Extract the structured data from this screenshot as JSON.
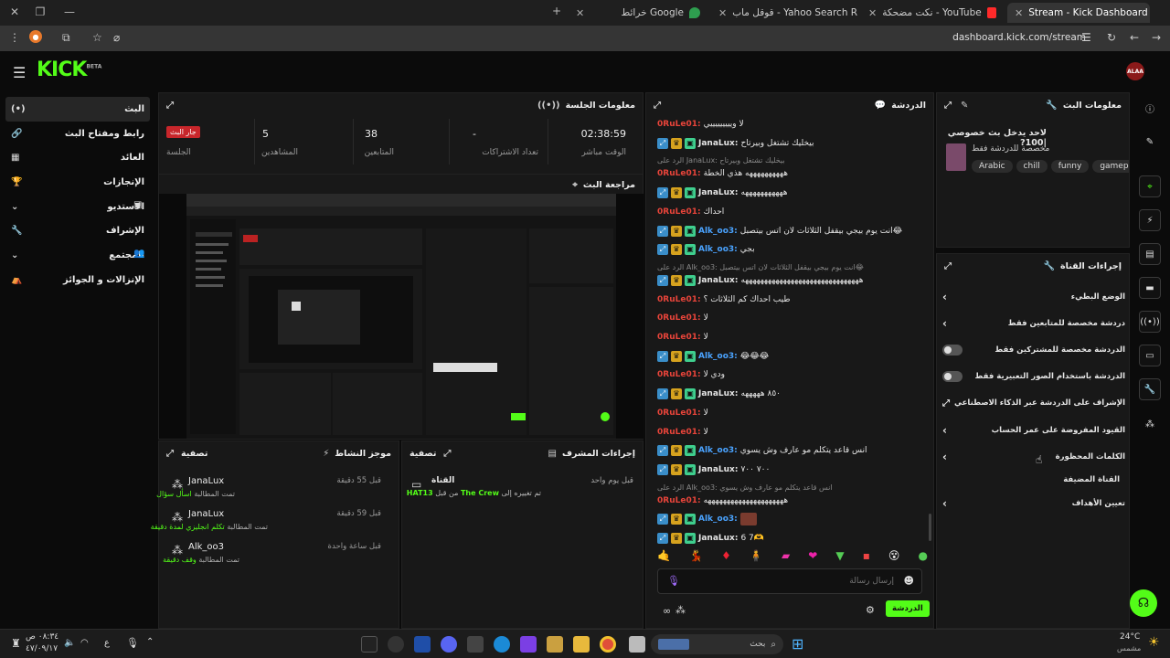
{
  "browser": {
    "tabs": [
      {
        "title": "Stream - Kick Dashboard",
        "active": true
      },
      {
        "title": "نكت مضحكة - YouTube",
        "active": false
      },
      {
        "title": "قوقل ماب - Yahoo Search Results",
        "active": false
      },
      {
        "title": "خرائط Google",
        "active": false
      }
    ],
    "url": "dashboard.kick.com/stream"
  },
  "header": {
    "logo": "KICK",
    "logo_sup": "BETA",
    "avatar": "ALAA"
  },
  "sidebar": {
    "items": [
      {
        "label": "البث",
        "icon": "(•)"
      },
      {
        "label": "رابط ومفتاح البث",
        "icon": "🔗"
      },
      {
        "label": "العائد",
        "icon": "▦"
      },
      {
        "label": "الإنجازات",
        "icon": "🏆"
      },
      {
        "label": "الاستديو",
        "icon": "▣"
      },
      {
        "label": "الإشراف",
        "icon": "🔧"
      },
      {
        "label": "المجتمع",
        "icon": "👥"
      },
      {
        "label": "الإنزالات و الجوائز",
        "icon": "⛺"
      }
    ]
  },
  "session": {
    "title": "معلومات الجلسة",
    "live_badge": "جار البث",
    "session_label": "الجلسة",
    "stats": [
      {
        "value": "02:38:59",
        "label": "الوقت مباشر"
      },
      {
        "value": "-",
        "label": "تعداد الاشتراكات"
      },
      {
        "value": "38",
        "label": "المتابعين"
      },
      {
        "value": "5",
        "label": "المشاهدين"
      }
    ]
  },
  "preview": {
    "title": "مراجعة البث"
  },
  "activity": {
    "title": "موجز النشاط",
    "filter": "تصفية",
    "items": [
      {
        "name": "JanaLux",
        "time": "قبل 55 دقيقة",
        "sub_prefix": "تمت المطالبة",
        "sub_reward": "اسأل سؤال"
      },
      {
        "name": "JanaLux",
        "time": "قبل 59 دقيقة",
        "sub_prefix": "تمت المطالبة",
        "sub_reward": "تكلم انجليزي لمدة دقيقة"
      },
      {
        "name": "Alk_oo3",
        "time": "قبل ساعة واحدة",
        "sub_prefix": "تمت المطالبة",
        "sub_reward": "وقف دقيقة"
      }
    ]
  },
  "modactions": {
    "title": "إجراءات المشرف",
    "filter": "تصفية",
    "item_title": "القناة",
    "item_time": "قبل يوم واحد",
    "item_text_prefix": "تم تغييره إلى",
    "item_user": "The Crew",
    "item_text_mid": "من قبل",
    "item_mod": "HAT13"
  },
  "chat": {
    "title": "الدردشة",
    "messages": [
      {
        "user": "0RuLe01:",
        "text": "لا ويييييييييي",
        "color": "#e8443a",
        "badges": []
      },
      {
        "user": "JanaLux:",
        "text": "بيخليك تشتغل وبيرتاح",
        "color": "#e6e6e6",
        "badges": [
          "mod",
          "crown",
          "sub"
        ]
      },
      {
        "reply": "الرد على JanaLux: بيخليك تشتغل وبيرتاح"
      },
      {
        "user": "0RuLe01:",
        "text": "ههههههههههه هذي الخطة",
        "color": "#e8443a",
        "badges": []
      },
      {
        "user": "JanaLux:",
        "text": "هههههههههههه",
        "color": "#e6e6e6",
        "badges": [
          "mod",
          "crown",
          "sub"
        ]
      },
      {
        "user": "0RuLe01:",
        "text": "احداك",
        "color": "#e8443a",
        "badges": []
      },
      {
        "user": "Alk_oo3:",
        "text": "انت يوم بيجي بيقفل الثلاثات لان اتس بيتصبل😂",
        "color": "#4aa3ff",
        "badges": [
          "mod",
          "crown",
          "sub"
        ]
      },
      {
        "user": "Alk_oo3:",
        "text": "بجي",
        "color": "#4aa3ff",
        "badges": [
          "mod",
          "crown",
          "sub"
        ]
      },
      {
        "reply": "الرد على Alk_oo3: انت يوم بيجي بيقفل الثلاثات لان اتس بيتصبل😂"
      },
      {
        "user": "JanaLux:",
        "text": "هههههههههههههههههههههههههههههههه",
        "color": "#e6e6e6",
        "badges": [
          "mod",
          "crown",
          "sub"
        ]
      },
      {
        "user": "0RuLe01:",
        "text": "طيب احداك كم الثلاثات ؟",
        "color": "#e8443a",
        "badges": []
      },
      {
        "user": "0RuLe01:",
        "text": "لا",
        "color": "#e8443a",
        "badges": []
      },
      {
        "user": "0RuLe01:",
        "text": "لا",
        "color": "#e8443a",
        "badges": []
      },
      {
        "user": "Alk_oo3:",
        "text": "😂😂😂",
        "color": "#4aa3ff",
        "badges": [
          "mod",
          "crown",
          "sub"
        ]
      },
      {
        "user": "0RuLe01:",
        "text": "ودي لا",
        "color": "#e8443a",
        "badges": []
      },
      {
        "user": "JanaLux:",
        "text": "٨٥٠ هههههه",
        "color": "#e6e6e6",
        "badges": [
          "mod",
          "crown",
          "sub"
        ]
      },
      {
        "user": "0RuLe01:",
        "text": "لا",
        "color": "#e8443a",
        "badges": []
      },
      {
        "user": "0RuLe01:",
        "text": "لا",
        "color": "#e8443a",
        "badges": []
      },
      {
        "user": "Alk_oo3:",
        "text": "انس قاعد يتكلم مو عارف وش يسوي",
        "color": "#4aa3ff",
        "badges": [
          "mod",
          "crown",
          "sub"
        ]
      },
      {
        "user": "JanaLux:",
        "text": "٧٠٠ ٧٠٠",
        "color": "#e6e6e6",
        "badges": [
          "mod",
          "crown",
          "sub"
        ]
      },
      {
        "reply": "الرد على Alk_oo3: انس قاعد يتكلم مو عارف وش يسوي"
      },
      {
        "user": "0RuLe01:",
        "text": "هههههههههههههههههههههه",
        "color": "#e8443a",
        "badges": []
      },
      {
        "user": "Alk_oo3:",
        "text": "",
        "color": "#4aa3ff",
        "badges": [
          "mod",
          "crown",
          "sub"
        ],
        "image": true
      },
      {
        "user": "JanaLux:",
        "text": "6 7🫶",
        "color": "#e6e6e6",
        "badges": [
          "mod",
          "crown",
          "sub"
        ]
      }
    ],
    "input_placeholder": "إرسال رسالة",
    "send_label": "الدردشة"
  },
  "stream_info": {
    "title": "معلومات البث",
    "stream_title": "لاحد يدخل بث خصوصي |100?",
    "category": "مخصصة للدردشة فقط",
    "tags": [
      "Arabic",
      "chill",
      "funny",
      "gameplay"
    ]
  },
  "channel_actions": {
    "title": "إجراءات القناة",
    "rows": [
      {
        "label": "الوضع البطيء",
        "control": "chevron"
      },
      {
        "label": "دردشة مخصصة للمتابعين فقط",
        "control": "chevron"
      },
      {
        "label": "الدردشة مخصصة للمشتركين فقط",
        "control": "toggle"
      },
      {
        "label": "الدردشة باستخدام الصور التعبيرية فقط",
        "control": "toggle"
      },
      {
        "label": "الإشراف على الدردشة عبر الذكاء الاصطناعي",
        "control": "link"
      },
      {
        "label": "القيود المفروضة على عمر الحساب",
        "control": "chevron"
      },
      {
        "label": "الكلمات المحظورة",
        "control": "chevron"
      }
    ],
    "section": "القناة المضيفة",
    "target_row": "تعيين الأهداف"
  },
  "taskbar": {
    "search": "بحث",
    "time": "٠٨:٣٤ ص",
    "date": "٤٧/٠٩/١٧",
    "lang": "ع",
    "weather_temp": "24°C",
    "weather_desc": "مشمس"
  }
}
